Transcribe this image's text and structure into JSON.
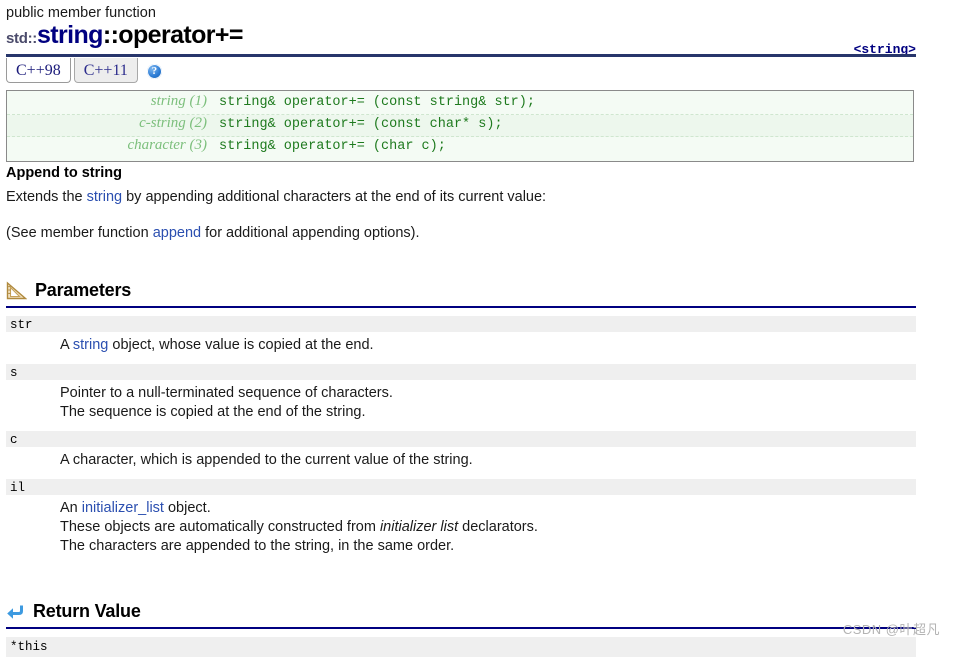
{
  "header": {
    "kind": "public member function",
    "namespace": "std::",
    "class_name": "string",
    "member": "::operator+=",
    "include_header": "<string>"
  },
  "tabs": [
    {
      "label": "C++98",
      "active": true
    },
    {
      "label": "C++11",
      "active": false
    }
  ],
  "help": {
    "glyph": "?"
  },
  "signatures": [
    {
      "tag": "string (1)",
      "code": "string& operator+= (const string& str);"
    },
    {
      "tag": "c-string (2)",
      "code": "string& operator+= (const char* s);"
    },
    {
      "tag": "character (3)",
      "code": "string& operator+= (char c);"
    }
  ],
  "description": {
    "heading": "Append to string",
    "p1_before": "Extends the ",
    "p1_link": "string",
    "p1_after": " by appending additional characters at the end of its current value:",
    "p2_before": "(See member function ",
    "p2_link": "append",
    "p2_after": " for additional appending options)."
  },
  "parameters_section": {
    "title": "Parameters",
    "icon": "ruler-icon",
    "items": [
      {
        "name": "str",
        "lines": [
          {
            "segments": [
              {
                "text": "A ",
                "style": "plain"
              },
              {
                "text": "string",
                "style": "link"
              },
              {
                "text": " object, whose value is copied at the end.",
                "style": "plain"
              }
            ]
          }
        ]
      },
      {
        "name": "s",
        "lines": [
          {
            "segments": [
              {
                "text": "Pointer to a null-terminated sequence of characters.",
                "style": "plain"
              }
            ]
          },
          {
            "segments": [
              {
                "text": "The sequence is copied at the end of the string.",
                "style": "plain"
              }
            ]
          }
        ]
      },
      {
        "name": "c",
        "lines": [
          {
            "segments": [
              {
                "text": "A character, which is appended to the current value of the string.",
                "style": "plain"
              }
            ]
          }
        ]
      },
      {
        "name": "il",
        "lines": [
          {
            "segments": [
              {
                "text": "An ",
                "style": "plain"
              },
              {
                "text": "initializer_list",
                "style": "link"
              },
              {
                "text": " object.",
                "style": "plain"
              }
            ]
          },
          {
            "segments": [
              {
                "text": "These objects are automatically constructed from ",
                "style": "plain"
              },
              {
                "text": "initializer list",
                "style": "italic"
              },
              {
                "text": " declarators.",
                "style": "plain"
              }
            ]
          },
          {
            "segments": [
              {
                "text": "The characters are appended to the string, in the same order.",
                "style": "plain"
              }
            ]
          }
        ]
      }
    ]
  },
  "return_section": {
    "title": "Return Value",
    "icon": "return-arrow-icon",
    "value": "*this"
  },
  "watermark": {
    "text": "CSDN @叶超凡"
  },
  "colors": {
    "accent_navy": "#000080",
    "rule_dark": "#27356b",
    "link": "#2b4fb0",
    "code_green": "#1e7a1e",
    "code_tag_green": "#7cbf7c",
    "param_bar": "#efefef"
  }
}
